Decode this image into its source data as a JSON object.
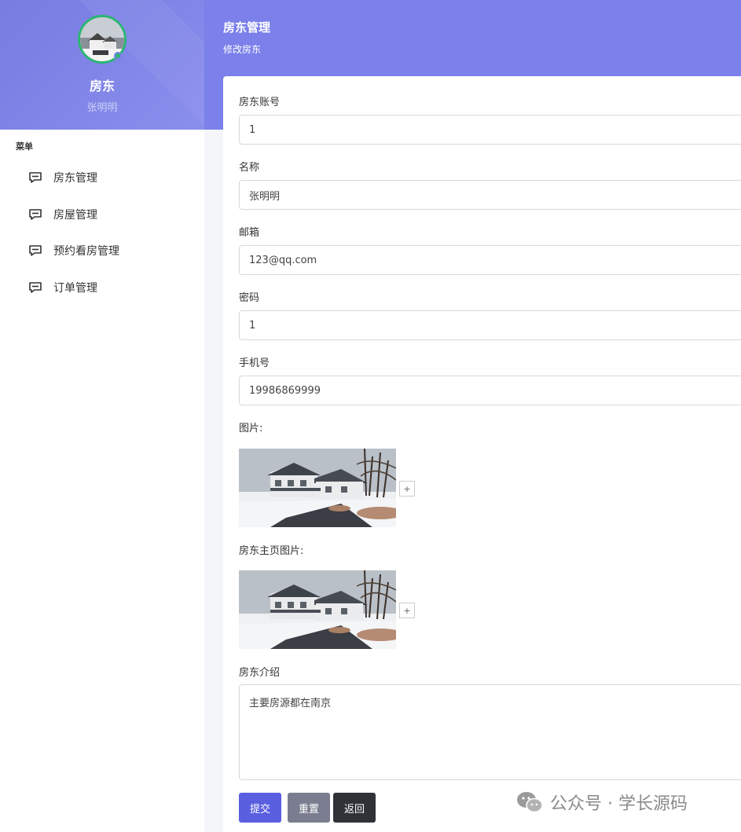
{
  "sidebar": {
    "role": "房东",
    "user_name": "张明明",
    "menu_title": "菜单",
    "items": [
      {
        "label": "房东管理"
      },
      {
        "label": "房屋管理"
      },
      {
        "label": "预约看房管理"
      },
      {
        "label": "订单管理"
      }
    ]
  },
  "header": {
    "title": "房东管理",
    "subtitle": "修改房东"
  },
  "form": {
    "account_label": "房东账号",
    "account_value": "1",
    "name_label": "名称",
    "name_value": "张明明",
    "email_label": "邮箱",
    "email_value": "123@qq.com",
    "password_label": "密码",
    "password_value": "1",
    "phone_label": "手机号",
    "phone_value": "19986869999",
    "image_label": "图片:",
    "home_image_label": "房东主页图片:",
    "intro_label": "房东介绍",
    "intro_value": "主要房源都在南京",
    "plus": "+",
    "submit": "提交",
    "reset": "重置",
    "back": "返回"
  },
  "watermark": "公众号 · 学长源码",
  "icons": {
    "menu": "comment-icon",
    "watermark": "wechat-icon"
  }
}
